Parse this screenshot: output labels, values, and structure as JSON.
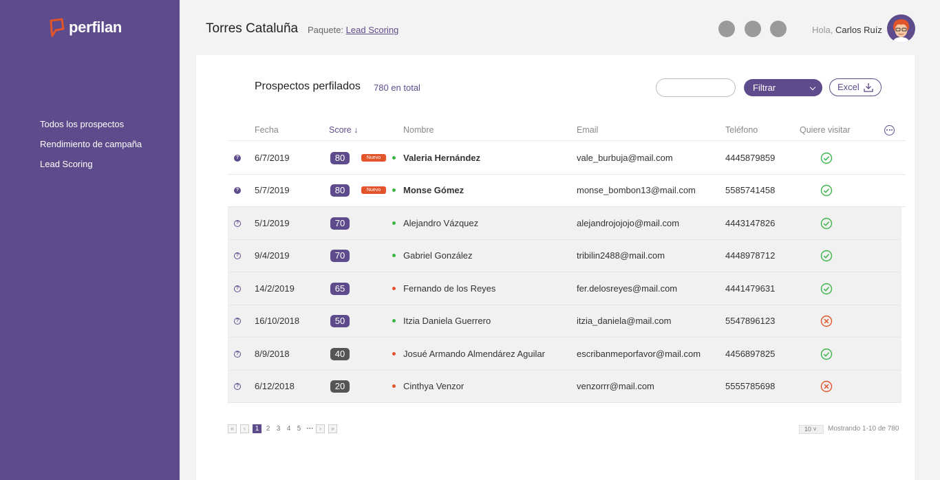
{
  "brand": {
    "name": "perfilan"
  },
  "sidebar": {
    "items": [
      {
        "label": "Todos los prospectos"
      },
      {
        "label": "Rendimiento de campaña"
      },
      {
        "label": "Lead Scoring"
      }
    ]
  },
  "header": {
    "company": "Torres Cataluña",
    "package_label": "Paquete:",
    "package_link": "Lead Scoring",
    "greeting": "Hola,",
    "user": "Carlos Ruíz"
  },
  "main": {
    "title": "Prospectos perfilados",
    "total": "780 en total",
    "search_placeholder": "",
    "filter_label": "Filtrar",
    "excel_label": "Excel"
  },
  "table": {
    "columns": {
      "fecha": "Fecha",
      "score": "Score",
      "nombre": "Nombre",
      "email": "Email",
      "telefono": "Teléfono",
      "visita": "Quiere visitar"
    },
    "new_badge": "Nuevo",
    "rows": [
      {
        "date": "6/7/2019",
        "score": "80",
        "new": true,
        "status": "green",
        "name": "Valeria Hernández",
        "email": "vale_burbuja@mail.com",
        "phone": "4445879859",
        "visit": "yes"
      },
      {
        "date": "5/7/2019",
        "score": "80",
        "new": true,
        "status": "green",
        "name": "Monse Gómez",
        "email": "monse_bombon13@mail.com",
        "phone": "5585741458",
        "visit": "yes"
      },
      {
        "date": "5/1/2019",
        "score": "70",
        "new": false,
        "status": "green",
        "name": "Alejandro Vázquez",
        "email": "alejandrojojojo@mail.com",
        "phone": "4443147826",
        "visit": "yes"
      },
      {
        "date": "9/4/2019",
        "score": "70",
        "new": false,
        "status": "green",
        "name": "Gabriel González",
        "email": "tribilin2488@mail.com",
        "phone": "4448978712",
        "visit": "yes"
      },
      {
        "date": "14/2/2019",
        "score": "65",
        "new": false,
        "status": "red",
        "name": "Fernando de los Reyes",
        "email": "fer.delosreyes@mail.com",
        "phone": "4441479631",
        "visit": "yes"
      },
      {
        "date": "16/10/2018",
        "score": "50",
        "new": false,
        "status": "green",
        "name": "Itzia Daniela Guerrero",
        "email": "itzia_daniela@mail.com",
        "phone": "5547896123",
        "visit": "no"
      },
      {
        "date": "8/9/2018",
        "score": "40",
        "new": false,
        "status": "red",
        "name": "Josué Armando Almendárez Aguilar",
        "email": "escribanmeporfavor@mail.com",
        "phone": "4456897825",
        "visit": "yes"
      },
      {
        "date": "6/12/2018",
        "score": "20",
        "new": false,
        "status": "red",
        "name": "Cinthya Venzor",
        "email": "venzorrr@mail.com",
        "phone": "5555785698",
        "visit": "no"
      }
    ]
  },
  "pagination": {
    "pages": [
      "1",
      "2",
      "3",
      "4",
      "5"
    ],
    "current": "1",
    "per_page": "10",
    "showing": "Mostrando 1-10 de 780"
  },
  "colors": {
    "brand": "#5e4b8b",
    "badge_high": "#5e4b8b",
    "badge_low": "#555555",
    "new": "#e2542a",
    "ok": "#3bb54a",
    "bad": "#e2542a"
  }
}
